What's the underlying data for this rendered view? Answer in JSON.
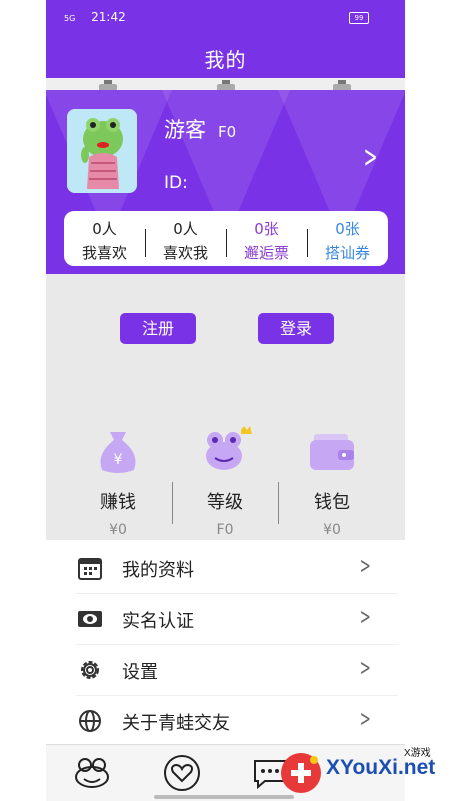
{
  "status_bar": {
    "time": "21:42",
    "network": "5G",
    "battery": "99"
  },
  "header": {
    "title": "我的"
  },
  "profile": {
    "name": "游客",
    "level": "F0",
    "id_label": "ID:"
  },
  "stats": [
    {
      "value": "0人",
      "label": "我喜欢"
    },
    {
      "value": "0人",
      "label": "喜欢我"
    },
    {
      "value": "0张",
      "label": "邂逅票"
    },
    {
      "value": "0张",
      "label": "搭讪券"
    }
  ],
  "auth": {
    "register": "注册",
    "login": "登录"
  },
  "features": [
    {
      "name": "赚钱",
      "value": "¥0",
      "icon": "money-bag-icon"
    },
    {
      "name": "等级",
      "value": "F0",
      "icon": "frog-crown-icon"
    },
    {
      "name": "钱包",
      "value": "¥0",
      "icon": "wallet-icon"
    }
  ],
  "menu": [
    {
      "label": "我的资料",
      "icon": "calendar-icon"
    },
    {
      "label": "实名认证",
      "icon": "eye-card-icon"
    },
    {
      "label": "设置",
      "icon": "gear-icon"
    },
    {
      "label": "关于青蛙交友",
      "icon": "globe-icon"
    }
  ],
  "tabbar": [
    "frog-icon",
    "heart-icon",
    "message-icon"
  ],
  "watermark": {
    "brand": "XYouXi.net",
    "small": "X游戏"
  },
  "colors": {
    "primary": "#7a32e6",
    "purple_text": "#8b3bd6",
    "blue_text": "#3a87de",
    "gray_bg": "#e9e9e9",
    "icon_light": "#c6a7f3"
  }
}
